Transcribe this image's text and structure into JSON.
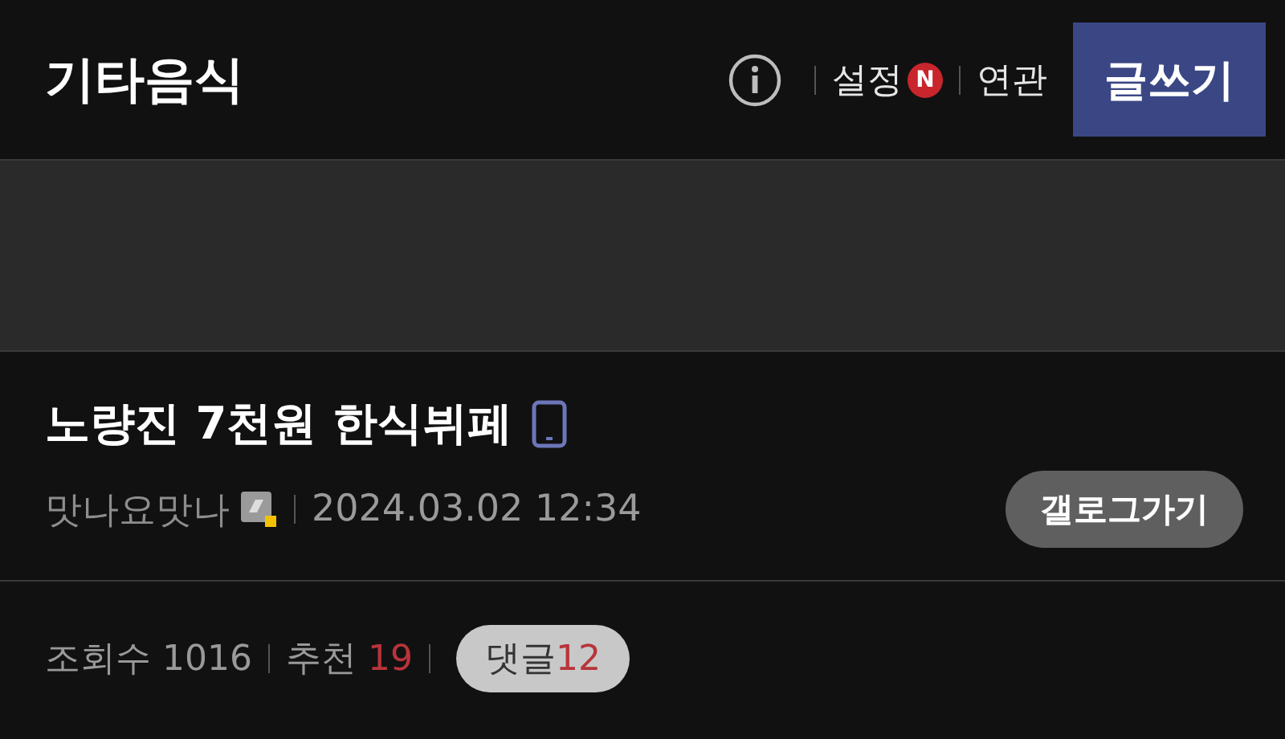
{
  "header": {
    "title": "기타음식",
    "settings": {
      "label": "설정",
      "badge": "N"
    },
    "related": "연관",
    "write_button": "글쓰기"
  },
  "post": {
    "title": "노량진 7천원 한식뷔페",
    "author": "맛나요맛나",
    "date": "2024.03.02 12:34",
    "gallery_button": "갤로그가기"
  },
  "stats": {
    "views_label": "조회수",
    "views": "1016",
    "recommend_label": "추천",
    "recommend": "19",
    "comments_label": "댓글",
    "comments": "12"
  }
}
